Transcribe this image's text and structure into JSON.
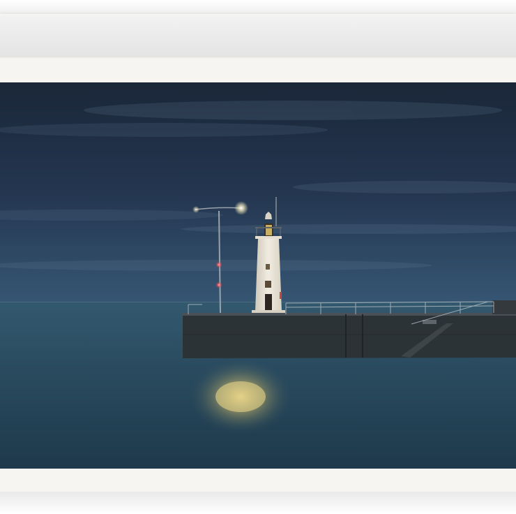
{
  "artwork": {
    "subject": "lighthouse-pier-at-dusk",
    "palette": {
      "sky_top": "#1d2a40",
      "sky_horizon": "#34506c",
      "sea": "#2b4d62",
      "sea_dark": "#1f3a4c",
      "pier": "#2b3236",
      "lighthouse": "#e9e4d8",
      "lamp_glow": "#f4dc8a",
      "signal_red": "#e0404a",
      "paper": "#f6f5f1"
    }
  }
}
